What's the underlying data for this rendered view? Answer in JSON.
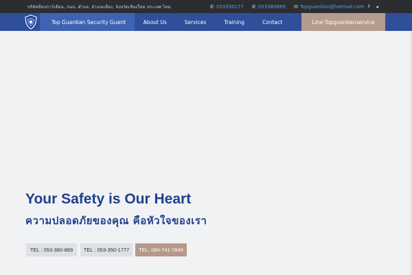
{
  "topbar": {
    "address": "บริษัทท็อปการ์เดียน, ถนน, ตำบล, อำเภอเมือง, จังหวัดเชียงใหม่ ประเทศ ไทย",
    "phone1": "053350177",
    "phone2": "053380889",
    "email": "Topguardian@hotmail.com",
    "phone_icon": "phone-icon",
    "mail_icon": "mail-icon",
    "facebook_icon": "facebook-icon",
    "youtube_icon": "youtube-icon"
  },
  "nav": {
    "brand": "Top Guardian Security Guard",
    "items": [
      "About Us",
      "Services",
      "Training",
      "Contact"
    ],
    "line": "Line:Topguardianservice"
  },
  "hero": {
    "title": "Your Safety is Our Heart",
    "subtitle": "ความปลอดภัยของคุณ คือหัวใจของเรา"
  },
  "buttons": {
    "tel1": "TEL : 053-380-889",
    "tel2": "TEL : 053-350-1777",
    "tel3": "TEL: 084-741-7849"
  },
  "colors": {
    "topbar": "#2b2d31",
    "navbar": "#2f4f9b",
    "brand_bg": "#3f63b3",
    "accent": "#b59b8e",
    "title": "#1f3f8f"
  }
}
